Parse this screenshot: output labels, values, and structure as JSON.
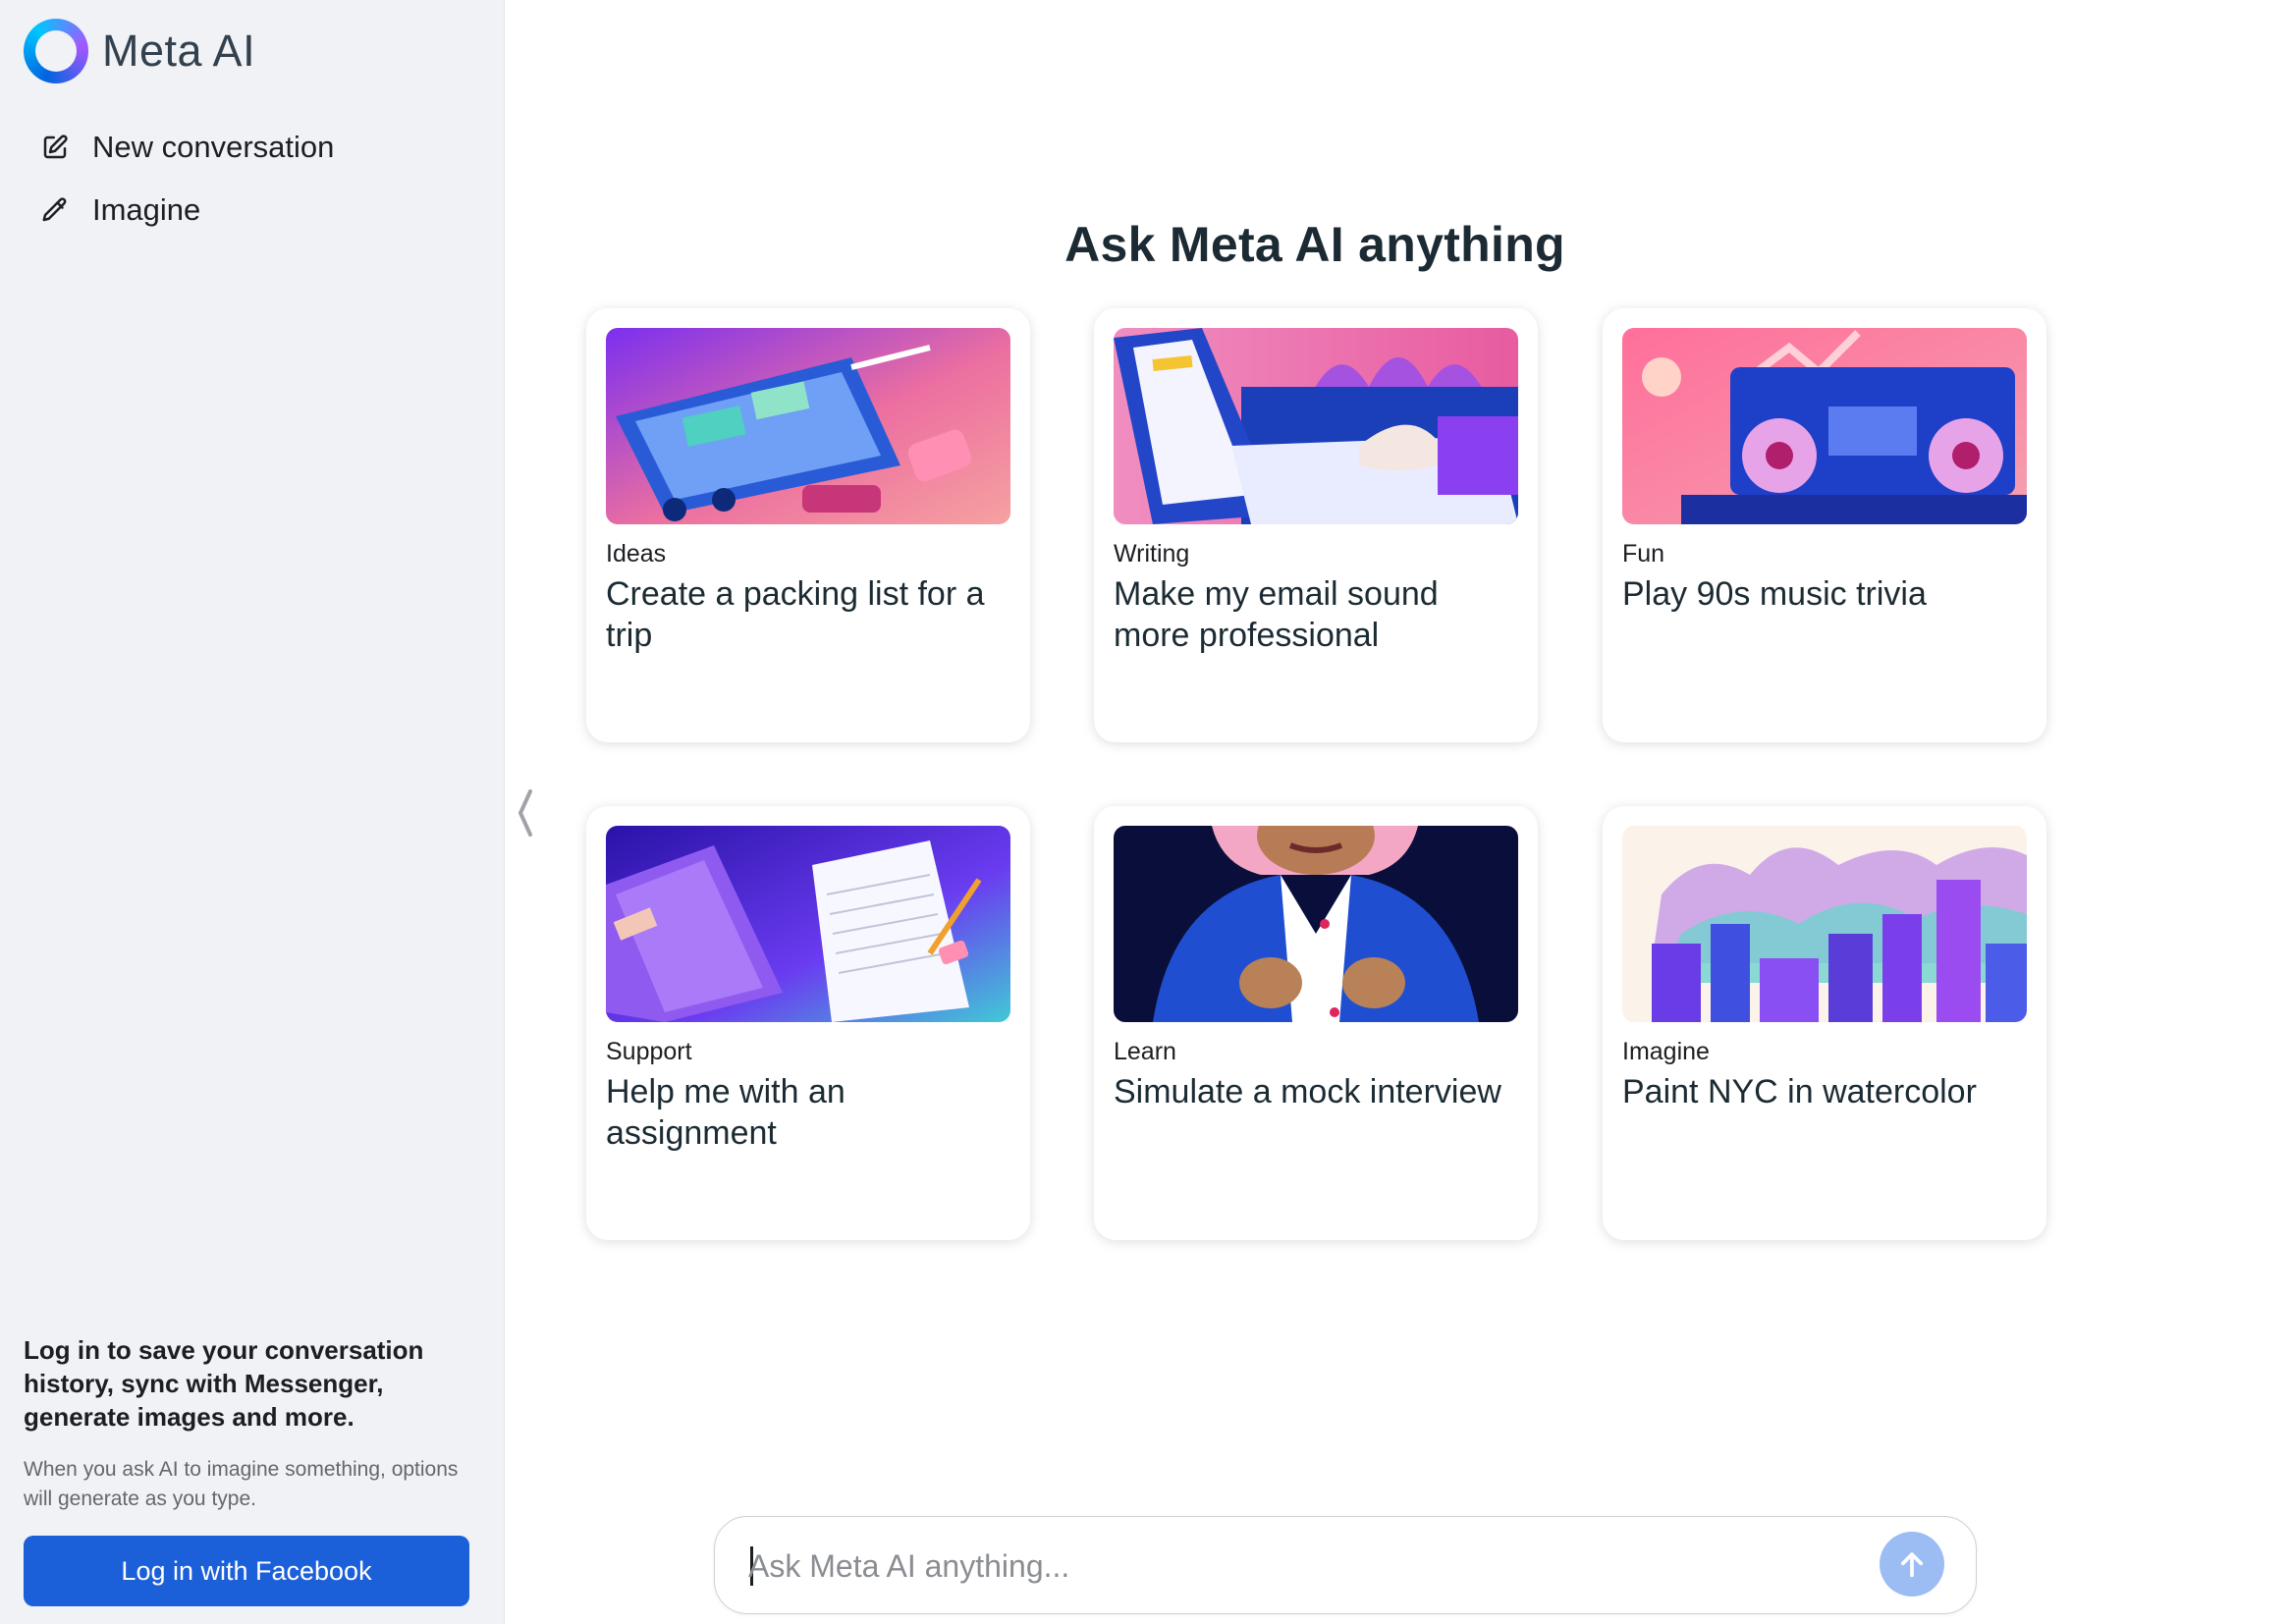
{
  "brand": {
    "name": "Meta AI"
  },
  "sidebar": {
    "items": [
      {
        "label": "New conversation",
        "icon": "compose-icon"
      },
      {
        "label": "Imagine",
        "icon": "pencil-icon"
      }
    ],
    "login": {
      "title": "Log in to save your conversation history, sync with Messenger, generate images and more.",
      "subtitle": "When you ask AI to imagine something, options will generate as you type.",
      "button_label": "Log in with Facebook"
    }
  },
  "main": {
    "headline": "Ask Meta AI anything",
    "cards": [
      {
        "category": "Ideas",
        "prompt": "Create a packing list for a trip",
        "image": "suitcase-illustration"
      },
      {
        "category": "Writing",
        "prompt": "Make my email sound more professional",
        "image": "laptop-illustration"
      },
      {
        "category": "Fun",
        "prompt": "Play 90s music trivia",
        "image": "boombox-illustration"
      },
      {
        "category": "Support",
        "prompt": "Help me with an assignment",
        "image": "notebook-illustration"
      },
      {
        "category": "Learn",
        "prompt": "Simulate a mock interview",
        "image": "interviewee-illustration"
      },
      {
        "category": "Imagine",
        "prompt": "Paint NYC in watercolor",
        "image": "city-watercolor-illustration"
      }
    ]
  },
  "composer": {
    "placeholder": "Ask Meta AI anything...",
    "value": ""
  },
  "colors": {
    "sidebar_bg": "#f1f2f5",
    "accent": "#1b5fd9",
    "send_button": "#9bbdf3"
  }
}
